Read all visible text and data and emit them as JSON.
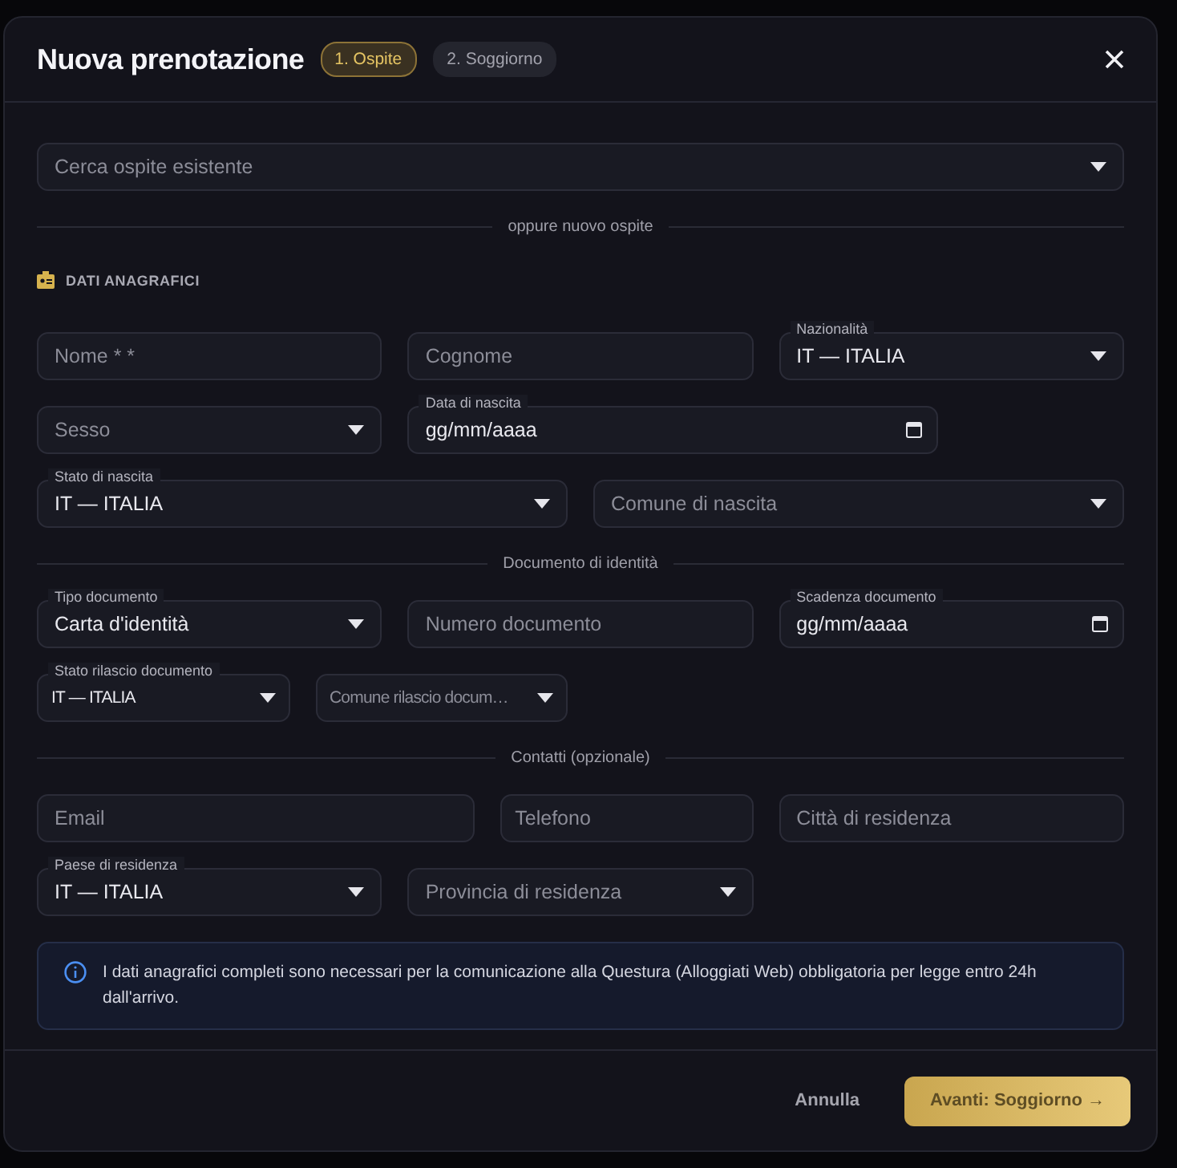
{
  "dialog": {
    "title": "Nuova prenotazione"
  },
  "steps": [
    {
      "label": "1. Ospite",
      "selected": true
    },
    {
      "label": "2. Soggiorno",
      "selected": false
    }
  ],
  "guest_search": {
    "kind": "select",
    "placeholder": "Cerca ospite esistente"
  },
  "sections": [
    {
      "divider": "oppure nuovo ospite",
      "heading": "DATI ANAGRAFICI",
      "rows": [
        [
          {
            "kind": "text",
            "placeholder": "Nome * *"
          },
          {
            "kind": "text",
            "placeholder": "Cognome"
          },
          {
            "kind": "select",
            "label": "Nazionalità",
            "value": "IT — ITALIA"
          }
        ],
        [
          {
            "kind": "select",
            "placeholder": "Sesso"
          },
          {
            "kind": "date",
            "label": "Data di nascita",
            "value": "gg/mm/aaaa"
          }
        ],
        [
          {
            "kind": "select",
            "label": "Stato di nascita",
            "value": "IT — ITALIA"
          },
          {
            "kind": "select",
            "placeholder": "Comune di nascita"
          }
        ]
      ]
    },
    {
      "divider": "Documento di identità",
      "rows": [
        [
          {
            "kind": "select",
            "label": "Tipo documento",
            "value": "Carta d'identità"
          },
          {
            "kind": "text",
            "placeholder": "Numero documento"
          },
          {
            "kind": "date",
            "label": "Scadenza documento",
            "value": "gg/mm/aaaa"
          }
        ],
        [
          {
            "kind": "select",
            "label": "Stato rilascio documento",
            "value": "IT — ITALIA"
          },
          {
            "kind": "select",
            "placeholder": "Comune rilascio docum…"
          }
        ]
      ]
    },
    {
      "divider": "Contatti (opzionale)",
      "rows": [
        [
          {
            "kind": "text",
            "placeholder": "Email"
          },
          {
            "kind": "text",
            "placeholder": "Telefono"
          },
          {
            "kind": "text",
            "placeholder": "Città di residenza"
          }
        ],
        [
          {
            "kind": "select",
            "label": "Paese di residenza",
            "value": "IT — ITALIA"
          },
          {
            "kind": "select",
            "placeholder": "Provincia di residenza"
          }
        ]
      ]
    }
  ],
  "notice": "I dati anagrafici completi sono necessari per la comunicazione alla Questura (Alloggiati Web) obbligatoria per legge entro 24h dall'arrivo.",
  "buttons": [
    {
      "label": "Annulla",
      "kind": "secondary",
      "disabled": false
    },
    {
      "label": "Avanti: Soggiorno →",
      "kind": "primary",
      "disabled": true
    }
  ]
}
